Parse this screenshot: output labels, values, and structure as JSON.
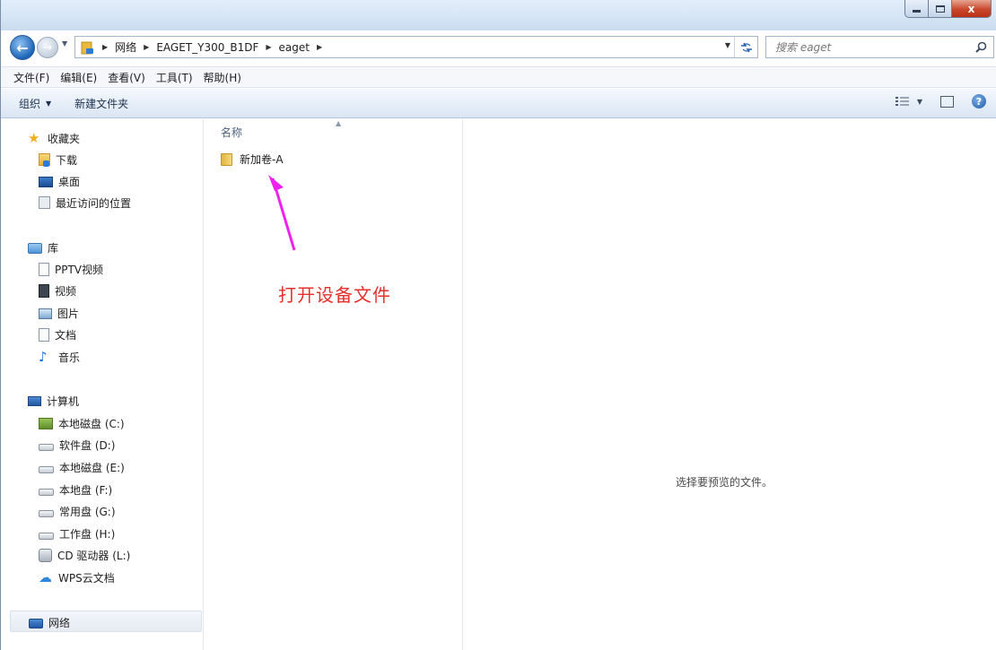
{
  "window": {
    "controls": {
      "close_label": "x"
    }
  },
  "address": {
    "crumbs": [
      "网络",
      "EAGET_Y300_B1DF",
      "eaget"
    ]
  },
  "search": {
    "placeholder": "搜索 eaget"
  },
  "menubar": {
    "items": [
      "文件(F)",
      "编辑(E)",
      "查看(V)",
      "工具(T)",
      "帮助(H)"
    ]
  },
  "commandbar": {
    "organize": "组织",
    "new_folder": "新建文件夹"
  },
  "sidebar": {
    "favorites": {
      "header": "收藏夹",
      "items": [
        "下载",
        "桌面",
        "最近访问的位置"
      ]
    },
    "libraries": {
      "header": "库",
      "items": [
        "PPTV视频",
        "视频",
        "图片",
        "文档",
        "音乐"
      ]
    },
    "computer": {
      "header": "计算机",
      "items": [
        "本地磁盘 (C:)",
        "软件盘 (D:)",
        "本地磁盘 (E:)",
        "本地盘 (F:)",
        "常用盘 (G:)",
        "工作盘 (H:)",
        "CD 驱动器 (L:)",
        "WPS云文档"
      ]
    },
    "network": {
      "header": "网络"
    }
  },
  "filelist": {
    "column_name": "名称",
    "files": [
      {
        "name": "新加卷-A",
        "type": "folder"
      }
    ],
    "annotation": "打开设备文件",
    "annotation_color": "#e5302b",
    "arrow_color": "#f020f0"
  },
  "preview": {
    "message": "选择要预览的文件。"
  },
  "icons": {
    "back": "back-arrow-icon",
    "forward": "forward-arrow-icon",
    "refresh": "refresh-icon",
    "search": "search-icon",
    "help": "help-icon",
    "views": "views-icon",
    "preview_pane": "preview-pane-icon"
  }
}
